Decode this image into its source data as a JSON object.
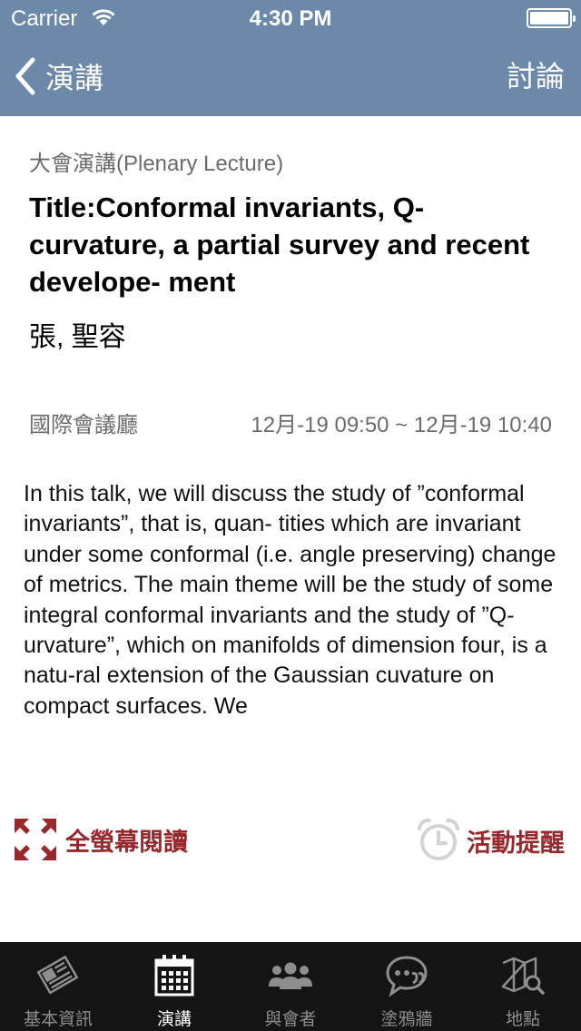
{
  "status_bar": {
    "carrier": "Carrier",
    "time": "4:30 PM"
  },
  "nav": {
    "back_label": "演講",
    "right_label": "討論"
  },
  "talk": {
    "category": "大會演講(Plenary Lecture)",
    "title": "Title:Conformal invariants, Q-curvature, a partial survey and recent develope- ment",
    "speaker": "張, 聖容",
    "venue": "國際會議廳",
    "time_range": "12月-19 09:50 ~ 12月-19 10:40",
    "abstract": "In this talk, we will discuss the study of ”conformal invariants”, that is, quan- tities which are invariant under some conformal (i.e. angle preserving) change of metrics. The main theme will be the study of some integral conformal invariants and the study of ”Q-urvature”, which on manifolds of dimension four, is a natu-ral extension of the Gaussian cuvature on compact surfaces. We"
  },
  "actions": {
    "fullscreen_label": "全螢幕閱讀",
    "reminder_label": "活動提醒"
  },
  "colors": {
    "nav_bg": "#6d89a9",
    "accent": "#98282b",
    "tabbar_bg": "#141414"
  },
  "tabbar": {
    "active_index": 1,
    "items": [
      {
        "label": "基本資訊",
        "icon": "newspaper-icon"
      },
      {
        "label": "演講",
        "icon": "calendar-icon"
      },
      {
        "label": "與會者",
        "icon": "people-icon"
      },
      {
        "label": "塗鴉牆",
        "icon": "chat-bubble-icon"
      },
      {
        "label": "地點",
        "icon": "map-search-icon"
      }
    ]
  }
}
